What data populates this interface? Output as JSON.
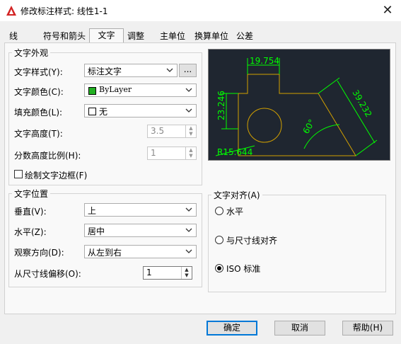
{
  "window": {
    "title": "修改标注样式: 线性1-1"
  },
  "tabs": [
    {
      "label": "线"
    },
    {
      "label": "符号和箭头"
    },
    {
      "label": "文字"
    },
    {
      "label": "调整"
    },
    {
      "label": "主单位"
    },
    {
      "label": "换算单位"
    },
    {
      "label": "公差"
    }
  ],
  "text_appearance": {
    "title": "文字外观",
    "style_label": "文字样式(Y):",
    "style_value": "标注文字",
    "style_more": "...",
    "color_label": "文字颜色(C):",
    "color_value": "ByLayer",
    "color_swatch": "#22b022",
    "fill_label": "填充颜色(L):",
    "fill_value": "无",
    "height_label": "文字高度(T):",
    "height_value": "3.5",
    "fraction_label": "分数高度比例(H):",
    "fraction_value": "1",
    "frame_label": "绘制文字边框(F)"
  },
  "text_placement": {
    "title": "文字位置",
    "vertical_label": "垂直(V):",
    "vertical_value": "上",
    "horizontal_label": "水平(Z):",
    "horizontal_value": "居中",
    "view_label": "观察方向(D):",
    "view_value": "从左到右",
    "offset_label": "从尺寸线偏移(O):",
    "offset_value": "1"
  },
  "text_alignment": {
    "title": "文字对齐(A)",
    "options": [
      {
        "label": "水平",
        "selected": false
      },
      {
        "label": "与尺寸线对齐",
        "selected": false
      },
      {
        "label": "ISO 标准",
        "selected": true
      }
    ]
  },
  "preview": {
    "dim_top": "19.754",
    "dim_left": "23.246",
    "dim_right": "39.232",
    "dim_angle": "60°",
    "dim_radius": "R15.644",
    "line_color": "#00ff00",
    "shape_color": "#d2a000",
    "background": "#1f2630"
  },
  "buttons": {
    "ok": "确定",
    "cancel": "取消",
    "help": "帮助(H)"
  }
}
